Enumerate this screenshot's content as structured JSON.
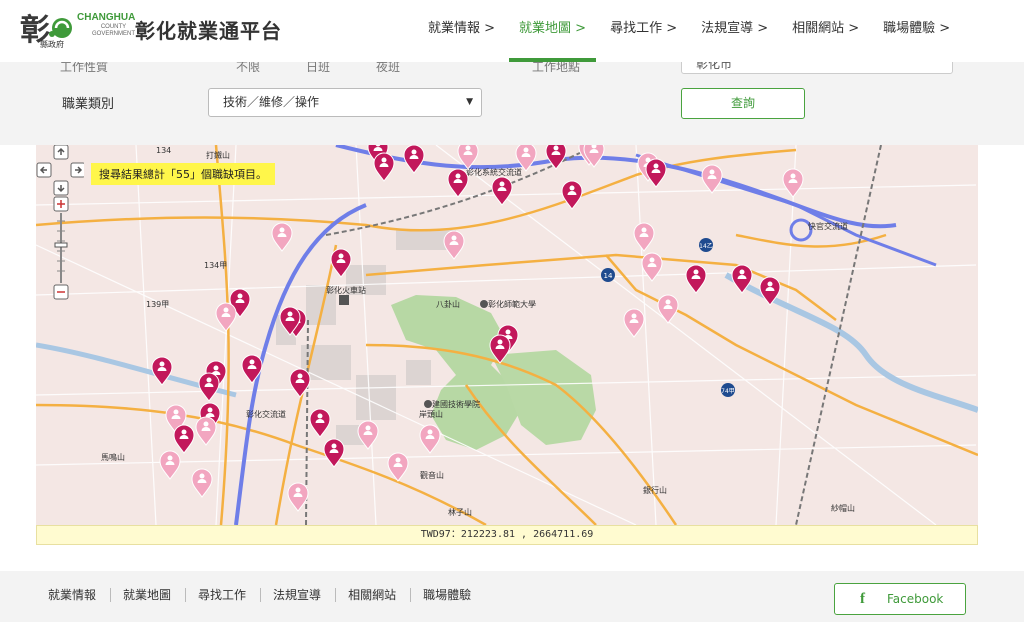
{
  "header": {
    "logo_glyph": "彰",
    "logo_en": "CHANGHUA",
    "logo_en_sub1": "COUNTY",
    "logo_en_sub2": "GOVERNMENT",
    "logo_gov": "縣政府",
    "title": "彰化就業通平台",
    "nav": [
      {
        "label": "就業情報 >"
      },
      {
        "label": "就業地圖 >"
      },
      {
        "label": "尋找工作 >"
      },
      {
        "label": "法規宣導 >"
      },
      {
        "label": "相關網站 >"
      },
      {
        "label": "職場體驗 >"
      }
    ],
    "active_color": "#3f9a3a"
  },
  "filter": {
    "ghost_labels": [
      "工作性質",
      "不限",
      "日班",
      "夜班",
      "工作地點"
    ],
    "region_value": "彰化市",
    "job_label": "職業類別",
    "job_value": "技術／維修／操作",
    "search_label": "查詢"
  },
  "map": {
    "result_tip": "搜尋結果總計「55」個職缺項目。",
    "coordinates": "TWD97：212223.81 , 2664711.69",
    "place_labels": {
      "dazhu": "打鐵山",
      "station": "彰化火車站",
      "bagua": "八卦山",
      "ncue": "彰化師範大學",
      "jianguo": "建國技術學院",
      "anshan": "岸頭山",
      "guanyin": "觀音山",
      "linzi": "林子山",
      "yinhang": "銀行山",
      "madong": "馬鳴山",
      "shama": "紗帽山",
      "interchange1": "彰化系統交流道",
      "interchange2": "彰化交流道",
      "interchange3": "快官交流道",
      "road134": "134",
      "road134a": "134甲",
      "road139a": "139甲",
      "road14": "14",
      "road14b": "14乙",
      "road74": "74甲"
    },
    "marker_colors": {
      "dark": "#c2185b",
      "light": "#f2a6c0"
    }
  },
  "footer": {
    "links": [
      "就業情報",
      "就業地圖",
      "尋找工作",
      "法規宣導",
      "相關網站",
      "職場體驗"
    ],
    "facebook_icon": "f",
    "facebook_label": "Facebook"
  }
}
